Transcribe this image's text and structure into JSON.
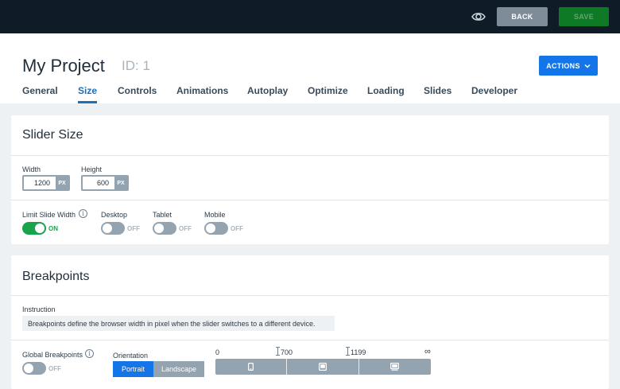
{
  "topbar": {
    "preview_icon": "eye-icon",
    "back_label": "BACK",
    "save_label": "SAVE"
  },
  "header": {
    "title": "My Project",
    "id_label": "ID: 1",
    "actions_label": "ACTIONS",
    "tabs": [
      {
        "label": "General"
      },
      {
        "label": "Size"
      },
      {
        "label": "Controls"
      },
      {
        "label": "Animations"
      },
      {
        "label": "Autoplay"
      },
      {
        "label": "Optimize"
      },
      {
        "label": "Loading"
      },
      {
        "label": "Slides"
      },
      {
        "label": "Developer"
      }
    ],
    "active_tab": "Size"
  },
  "slider_size": {
    "title": "Slider Size",
    "width": {
      "label": "Width",
      "value": "1200",
      "unit": "PX"
    },
    "height": {
      "label": "Height",
      "value": "600",
      "unit": "PX"
    },
    "limit_slide_width": {
      "label": "Limit Slide Width",
      "state": "ON"
    },
    "desktop": {
      "label": "Desktop",
      "state": "OFF"
    },
    "tablet": {
      "label": "Tablet",
      "state": "OFF"
    },
    "mobile": {
      "label": "Mobile",
      "state": "OFF"
    }
  },
  "breakpoints": {
    "title": "Breakpoints",
    "instruction_label": "Instruction",
    "instruction_text": "Breakpoints define the browser width in pixel when the slider switches to a different device.",
    "global_breakpoints": {
      "label": "Global Breakpoints",
      "state": "OFF"
    },
    "orientation": {
      "label": "Orientation",
      "options": [
        "Portrait",
        "Landscape"
      ],
      "selected": "Portrait"
    },
    "scale": {
      "start": "0",
      "points": [
        "700",
        "1199"
      ],
      "end": "∞"
    },
    "devices": [
      "mobile-icon",
      "tablet-icon",
      "desktop-icon"
    ]
  },
  "colors": {
    "topbar_bg": "#0f1b27",
    "primary": "#1375e8",
    "save": "#0f7a26",
    "toggle_on": "#19a34a",
    "toggle_off": "#94a3b0",
    "active_tab": "#1f6fb8"
  }
}
